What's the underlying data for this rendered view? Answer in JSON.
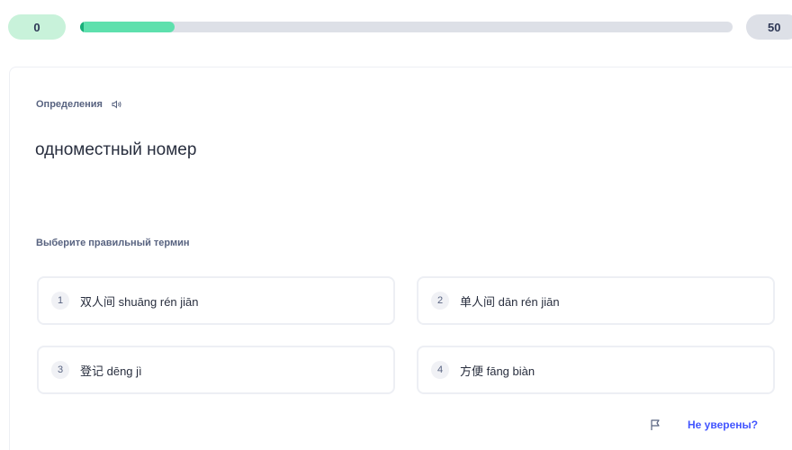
{
  "progress": {
    "current": "0",
    "total": "50",
    "fill_fraction": 0.145,
    "fill_color": "#5ee0ad",
    "track_color": "#dde0e7"
  },
  "card": {
    "section_label": "Определения",
    "speaker_icon": "speaker-icon",
    "definition": "одноместный номер",
    "prompt": "Выберите правильный термин"
  },
  "options": [
    {
      "number": "1",
      "text": "双人间 shuāng rén jiān"
    },
    {
      "number": "2",
      "text": "单人间 dān rén jiān"
    },
    {
      "number": "3",
      "text": "登记 dēng jì"
    },
    {
      "number": "4",
      "text": "方便 fāng biàn"
    }
  ],
  "footer": {
    "flag_icon": "flag-icon",
    "unsure_label": "Не уверены?",
    "link_color": "#4255ff"
  }
}
